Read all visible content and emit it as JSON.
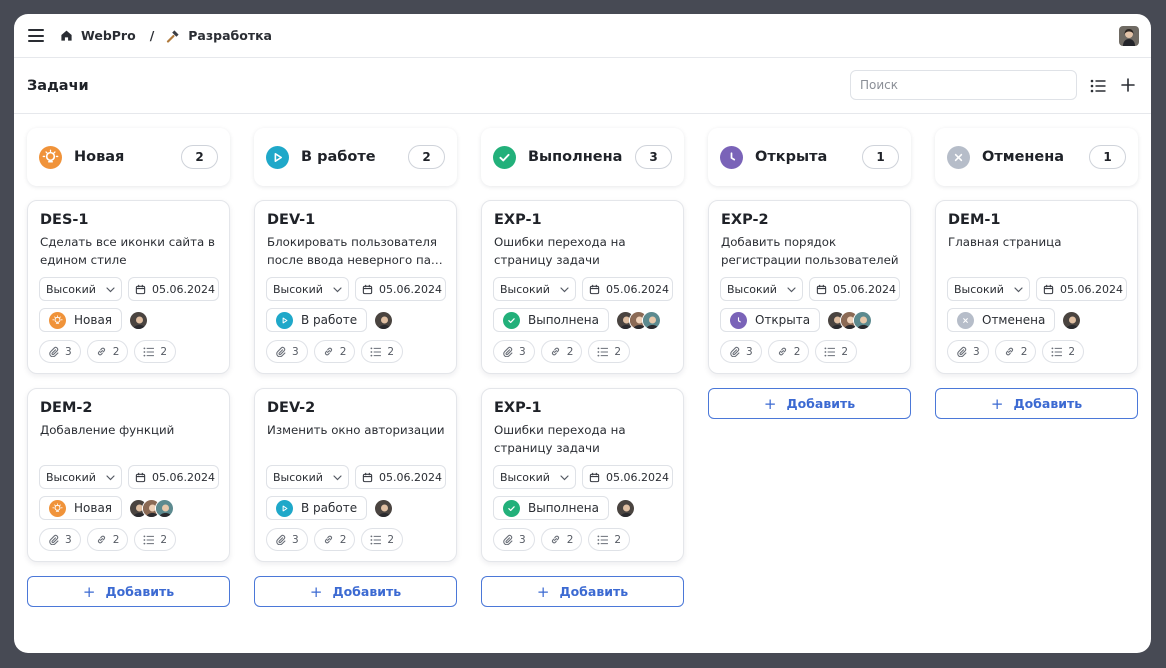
{
  "nav": {
    "workspace": "WebPro",
    "separator": "/",
    "project": "Разработка"
  },
  "header": {
    "title": "Задачи",
    "search_placeholder": "Поиск"
  },
  "colors": {
    "new": "#f0933a",
    "in_progress": "#1fa8c9",
    "done": "#22b07a",
    "open": "#7a63b8",
    "cancelled": "#b6bdc9",
    "accent": "#3c6ad2"
  },
  "add_label": "Добавить",
  "columns": [
    {
      "title": "Новая",
      "count": "2",
      "cards": [
        {
          "id": "DES-1",
          "desc": "Сделать все иконки сайта в едином стиле",
          "priority": "Высокий",
          "date": "05.06.2024",
          "status": "Новая",
          "attachments": "3",
          "links": "2",
          "subtasks": "2"
        },
        {
          "id": "DEM-2",
          "desc": "Добавление функций",
          "priority": "Высокий",
          "date": "05.06.2024",
          "status": "Новая",
          "attachments": "3",
          "links": "2",
          "subtasks": "2"
        }
      ]
    },
    {
      "title": "В работе",
      "count": "2",
      "cards": [
        {
          "id": "DEV-1",
          "desc": "Блокировать пользователя после ввода неверного па…",
          "priority": "Высокий",
          "date": "05.06.2024",
          "status": "В работе",
          "attachments": "3",
          "links": "2",
          "subtasks": "2"
        },
        {
          "id": "DEV-2",
          "desc": "Изменить окно авторизации",
          "priority": "Высокий",
          "date": "05.06.2024",
          "status": "В работе",
          "attachments": "3",
          "links": "2",
          "subtasks": "2"
        }
      ]
    },
    {
      "title": "Выполнена",
      "count": "3",
      "cards": [
        {
          "id": "EXP-1",
          "desc": "Ошибки перехода на страницу задачи",
          "priority": "Высокий",
          "date": "05.06.2024",
          "status": "Выполнена",
          "attachments": "3",
          "links": "2",
          "subtasks": "2"
        },
        {
          "id": "EXP-1",
          "desc": "Ошибки перехода на страницу задачи",
          "priority": "Высокий",
          "date": "05.06.2024",
          "status": "Выполнена",
          "attachments": "3",
          "links": "2",
          "subtasks": "2"
        }
      ]
    },
    {
      "title": "Открыта",
      "count": "1",
      "cards": [
        {
          "id": "EXP-2",
          "desc": "Добавить порядок регистрации пользователей",
          "priority": "Высокий",
          "date": "05.06.2024",
          "status": "Открыта",
          "attachments": "3",
          "links": "2",
          "subtasks": "2"
        }
      ]
    },
    {
      "title": "Отменена",
      "count": "1",
      "cards": [
        {
          "id": "DEM-1",
          "desc": "Главная страница",
          "priority": "Высокий",
          "date": "05.06.2024",
          "status": "Отменена",
          "attachments": "3",
          "links": "2",
          "subtasks": "2"
        }
      ]
    }
  ]
}
